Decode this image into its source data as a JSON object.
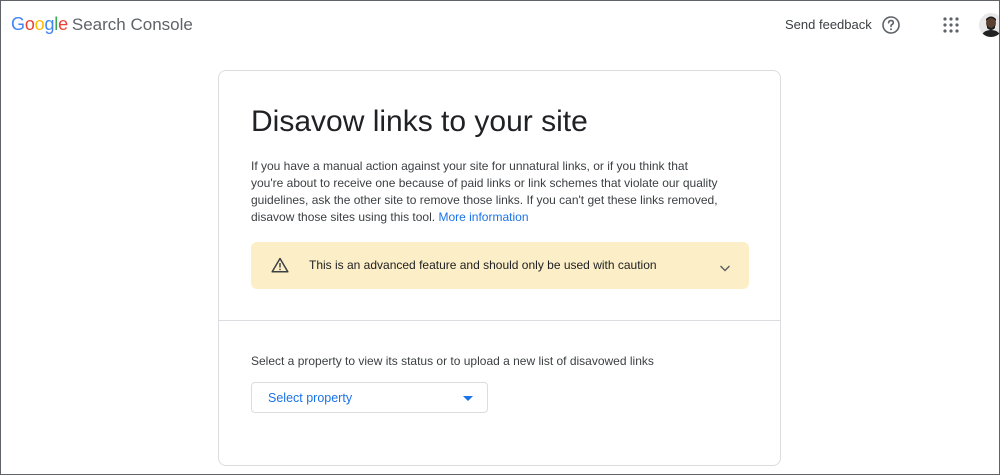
{
  "header": {
    "logo_text": "Google",
    "product": "Search Console",
    "feedback_label": "Send feedback"
  },
  "page": {
    "title": "Disavow links to your site",
    "description": "If you have a manual action against your site for unnatural links, or if you think that you're about to receive one because of paid links or link schemes that violate our quality guidelines, ask the other site to remove those links. If you can't get these links removed, disavow those sites using this tool.",
    "more_info_link": "More information"
  },
  "warning": {
    "text": "This is an advanced feature and should only be used with caution",
    "icon": "warning-triangle-icon"
  },
  "property": {
    "label": "Select a property to view its status or to upload a new list of disavowed links",
    "select_value": "Select property"
  },
  "colors": {
    "accent": "#1a73e8",
    "warning_bg": "#fcefc7"
  }
}
